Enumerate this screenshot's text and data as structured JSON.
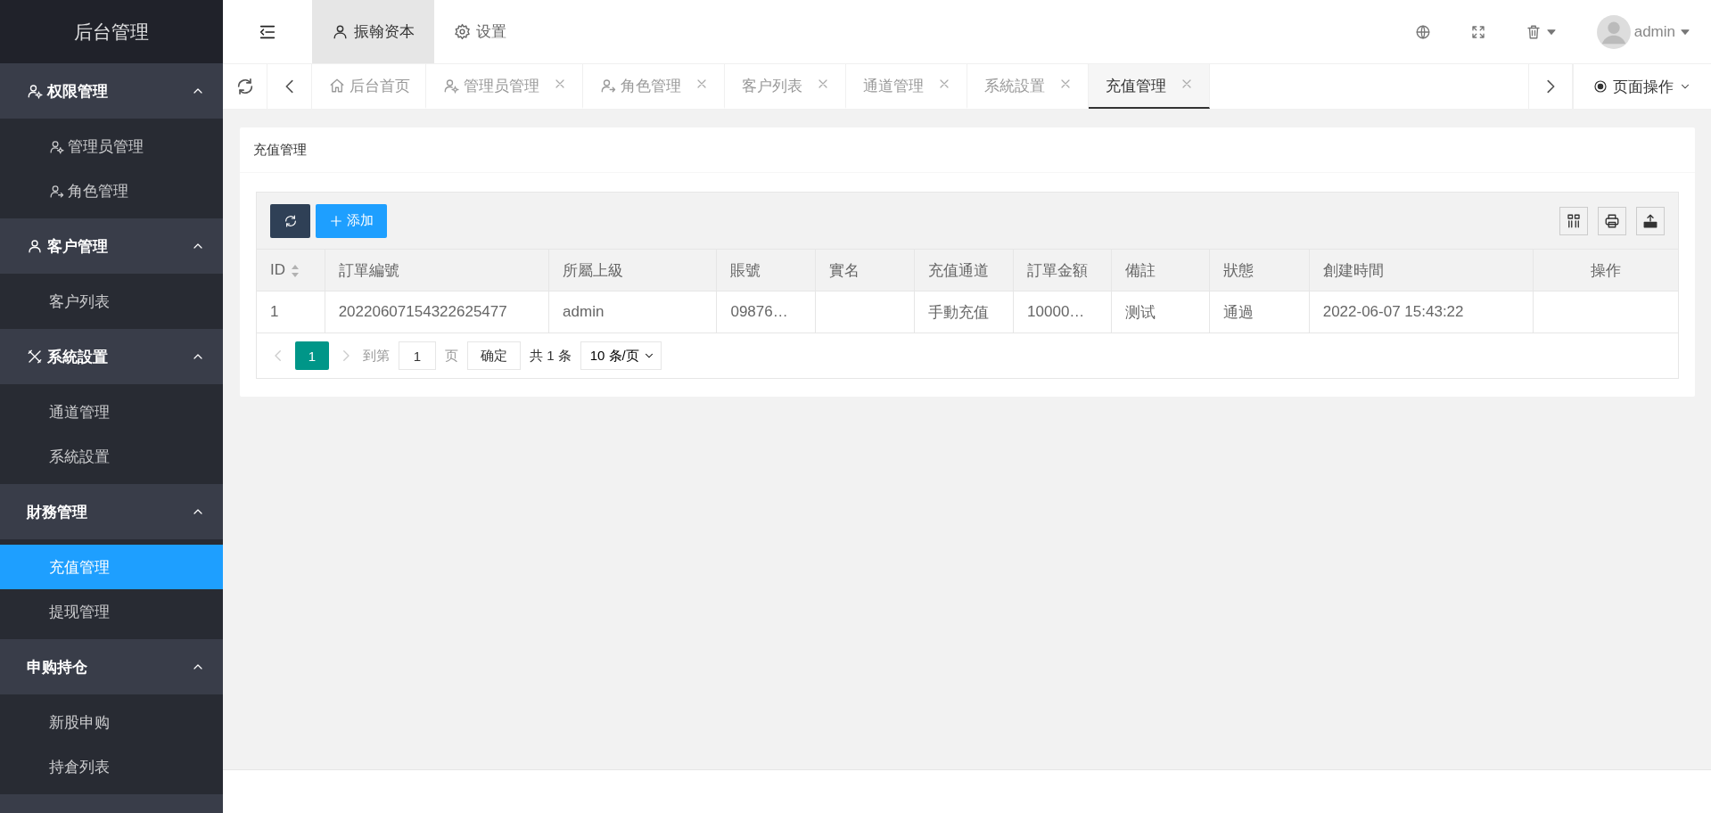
{
  "sidebar": {
    "logo": "后台管理",
    "groups": [
      {
        "label": "权限管理",
        "kind": "admin",
        "expanded": true,
        "items": [
          {
            "label": "管理员管理",
            "kind": "admin",
            "selected": false
          },
          {
            "label": "角色管理",
            "kind": "role",
            "selected": false
          }
        ]
      },
      {
        "label": "客户管理",
        "kind": "user",
        "expanded": true,
        "items": [
          {
            "label": "客户列表",
            "kind": "plain",
            "selected": false
          }
        ]
      },
      {
        "label": "系統設置",
        "kind": "tools",
        "expanded": true,
        "items": [
          {
            "label": "通道管理",
            "kind": "plain",
            "selected": false
          },
          {
            "label": "系統設置",
            "kind": "plain",
            "selected": false
          }
        ]
      },
      {
        "label": "財務管理",
        "kind": "plain",
        "expanded": true,
        "items": [
          {
            "label": "充值管理",
            "kind": "plain",
            "selected": true
          },
          {
            "label": "提现管理",
            "kind": "plain",
            "selected": false
          }
        ]
      },
      {
        "label": "申购持仓",
        "kind": "plain",
        "expanded": true,
        "items": [
          {
            "label": "新股申购",
            "kind": "plain",
            "selected": false
          },
          {
            "label": "持倉列表",
            "kind": "plain",
            "selected": false
          }
        ]
      }
    ]
  },
  "header": {
    "nav": [
      {
        "label": "振翰资本",
        "kind": "user",
        "selected": true
      },
      {
        "label": "设置",
        "kind": "gear",
        "selected": false
      }
    ],
    "user": "admin"
  },
  "tabs": [
    {
      "label": "后台首页",
      "kind": "home",
      "closable": false,
      "selected": false
    },
    {
      "label": "管理员管理",
      "kind": "admin",
      "closable": true,
      "selected": false
    },
    {
      "label": "角色管理",
      "kind": "role",
      "closable": true,
      "selected": false
    },
    {
      "label": "客户列表",
      "kind": "plain",
      "closable": true,
      "selected": false
    },
    {
      "label": "通道管理",
      "kind": "plain",
      "closable": true,
      "selected": false
    },
    {
      "label": "系統設置",
      "kind": "plain",
      "closable": true,
      "selected": false
    },
    {
      "label": "充值管理",
      "kind": "plain",
      "closable": true,
      "selected": true
    }
  ],
  "page_actions": "页面操作",
  "card": {
    "title": "充值管理",
    "add_button": "添加",
    "table": {
      "columns": [
        {
          "label": "ID",
          "sortable": true
        },
        {
          "label": "訂單編號",
          "sortable": false
        },
        {
          "label": "所屬上級",
          "sortable": false
        },
        {
          "label": "賬號",
          "sortable": false
        },
        {
          "label": "實名",
          "sortable": false
        },
        {
          "label": "充值通道",
          "sortable": false
        },
        {
          "label": "訂單金額",
          "sortable": false
        },
        {
          "label": "備註",
          "sortable": false
        },
        {
          "label": "狀態",
          "sortable": false
        },
        {
          "label": "創建時間",
          "sortable": false
        },
        {
          "label": "操作",
          "sortable": false
        }
      ],
      "rows": [
        [
          "1",
          "20220607154322625477",
          "admin",
          "09876…",
          null,
          "手動充值",
          "10000…",
          "测试",
          "通過",
          "2022-06-07 15:43:22",
          null
        ]
      ]
    },
    "pager": {
      "pages": [
        {
          "label": "1",
          "selected": true
        }
      ],
      "goto_label": "到第",
      "goto_value": "1",
      "page_unit": "页",
      "confirm": "确定",
      "total": "共 1 条",
      "page_size": "10 条/页"
    }
  }
}
